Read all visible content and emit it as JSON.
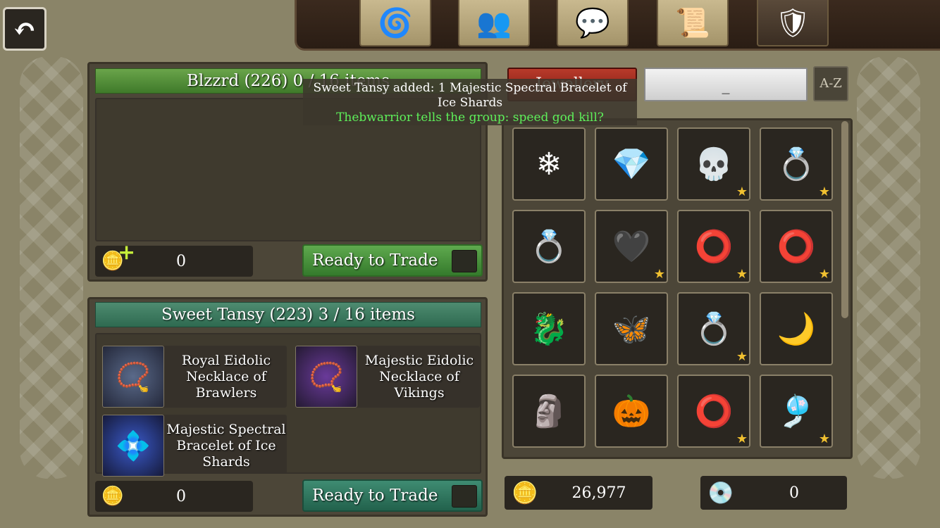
{
  "nav": {
    "back_icon": "back-arrow-icon",
    "tabs": [
      {
        "icon": "triskelion-icon",
        "glyph": "🌀"
      },
      {
        "icon": "group-icon",
        "glyph": "👥"
      },
      {
        "icon": "chat-icon",
        "glyph": "💬"
      },
      {
        "icon": "quest-scroll-icon",
        "glyph": "📜"
      },
      {
        "icon": "guild-shield-icon",
        "glyph": "🛡"
      }
    ]
  },
  "tooltip": {
    "line1": "Sweet Tansy added: 1 Majestic Spectral Bracelet of Ice Shards",
    "line2": "Thebwarrior tells the group: speed god kill?"
  },
  "my_side": {
    "title": "Blzzrd (226) 0 / 16 items",
    "gold": "0",
    "ready_label": "Ready to Trade"
  },
  "their_side": {
    "title": "Sweet Tansy (223) 3 / 16 items",
    "gold": "0",
    "ready_label": "Ready to Trade",
    "items": [
      {
        "name": "Royal Eidolic Necklace of Brawlers",
        "glyph": "📿"
      },
      {
        "name": "Majestic Eidolic Necklace of Vikings",
        "glyph": "📿"
      },
      {
        "name": "Majestic Spectral Bracelet of Ice Shards",
        "glyph": "💠"
      }
    ]
  },
  "inventory": {
    "filter_label": "Jewellery",
    "search_value": "_",
    "sort_label": "A-Z",
    "cells": [
      {
        "glyph": "❄",
        "star": false
      },
      {
        "glyph": "💎",
        "star": false
      },
      {
        "glyph": "💀",
        "star": true
      },
      {
        "glyph": "💍",
        "star": true
      },
      {
        "glyph": "💍",
        "star": false
      },
      {
        "glyph": "🖤",
        "star": true
      },
      {
        "glyph": "⭕",
        "star": true
      },
      {
        "glyph": "⭕",
        "star": true
      },
      {
        "glyph": "🐉",
        "star": false
      },
      {
        "glyph": "🦋",
        "star": false
      },
      {
        "glyph": "💍",
        "star": true
      },
      {
        "glyph": "🌙",
        "star": false
      },
      {
        "glyph": "🗿",
        "star": false
      },
      {
        "glyph": "🎃",
        "star": false
      },
      {
        "glyph": "⭕",
        "star": true
      },
      {
        "glyph": "🎐",
        "star": true
      }
    ],
    "gold": "26,977",
    "gems": "0"
  }
}
